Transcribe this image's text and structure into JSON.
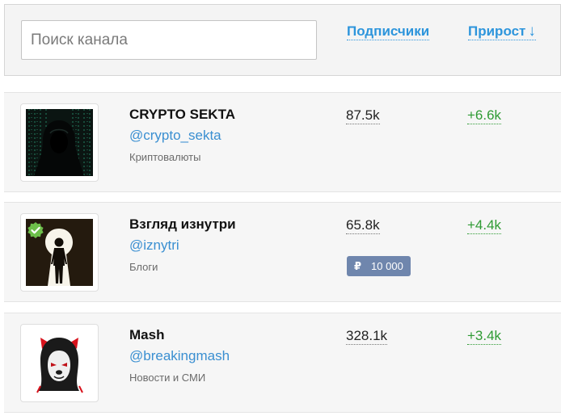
{
  "search": {
    "placeholder": "Поиск канала",
    "value": ""
  },
  "columns": {
    "subscribers_label": "Подписчики",
    "growth_label": "Прирост",
    "sort_arrow": "↓"
  },
  "colors": {
    "accent": "#2d95dc",
    "growth": "#2f9b34",
    "price_badge": "#6f86ad"
  },
  "channels": [
    {
      "name": "CRYPTO SEKTA",
      "handle": "@crypto_sekta",
      "category": "Криптовалюты",
      "subscribers": "87.5k",
      "growth": "+6.6k",
      "avatar_icon": "hooded-figure-matrix-avatar"
    },
    {
      "name": "Взгляд изнутри",
      "handle": "@iznytri",
      "category": "Блоги",
      "subscribers": "65.8k",
      "growth": "+4.4k",
      "avatar_icon": "keyhole-silhouette-avatar",
      "verified": true,
      "price": {
        "currency_symbol": "₽",
        "amount": "10 000"
      }
    },
    {
      "name": "Mash",
      "handle": "@breakingmash",
      "category": "Новости и СМИ",
      "subscribers": "328.1k",
      "growth": "+3.4k",
      "avatar_icon": "hooded-bear-avatar"
    }
  ]
}
